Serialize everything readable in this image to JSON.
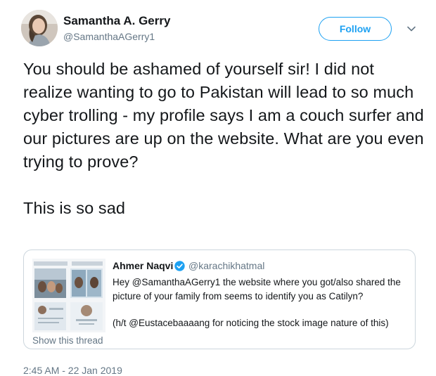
{
  "author": {
    "name": "Samantha A. Gerry",
    "handle": "@SamanthaAGerry1",
    "avatar_icon": "profile-photo"
  },
  "follow_label": "Follow",
  "menu_icon": "chevron-down-icon",
  "tweet_text": "You should be ashamed of yourself sir! I did not realize wanting to go to Pakistan will lead to so much cyber trolling - my profile says I am a couch surfer and our pictures are up on the website. What are you even trying to prove?\n\nThis is so sad",
  "quoted": {
    "name": "Ahmer Naqvi",
    "verified": true,
    "handle": "@karachikhatmal",
    "text_p1": "Hey @SamanthaAGerry1 the website where you got/also shared the picture of your family from seems to identify you as Catilyn?",
    "text_p2": "(h/t @Eustacebaaaang for noticing the stock image nature of this)",
    "show_thread": "Show this thread"
  },
  "timestamp": "2:45 AM - 22 Jan 2019",
  "colors": {
    "accent": "#1da1f2",
    "text": "#14171a",
    "muted": "#657786",
    "border": "#ccd6dd"
  }
}
